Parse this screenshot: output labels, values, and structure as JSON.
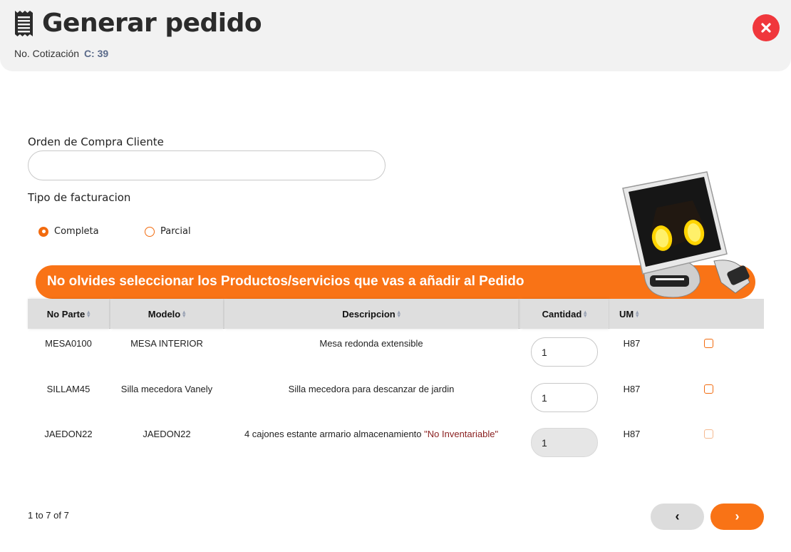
{
  "header": {
    "title": "Generar pedido",
    "quote_label": "No. Cotización",
    "quote_value": "C: 39"
  },
  "form": {
    "oc_label": "Orden de Compra Cliente",
    "oc_value": "",
    "billing_label": "Tipo de facturacion",
    "billing_options": [
      {
        "label": "Completa",
        "selected": true
      },
      {
        "label": "Parcial",
        "selected": false
      }
    ]
  },
  "banner": {
    "text": "No olvides seleccionar los Productos/servicios que vas a añadir al Pedido"
  },
  "table": {
    "columns": [
      "No Parte",
      "Modelo",
      "Descripcion",
      "Cantidad",
      "UM"
    ],
    "rows": [
      {
        "part": "MESA0100",
        "model": "MESA INTERIOR",
        "description": "Mesa redonda extensible",
        "note": "",
        "qty": "1",
        "um": "H87",
        "editable": true,
        "checked": false
      },
      {
        "part": "SILLAM45",
        "model": "Silla mecedora Vanely",
        "description": "Silla mecedora para descanzar de jardin",
        "note": "",
        "qty": "1",
        "um": "H87",
        "editable": true,
        "checked": false
      },
      {
        "part": "JAEDON22",
        "model": "JAEDON22",
        "description": "4 cajones estante armario almacenamiento",
        "note": "\"No Inventariable\"",
        "qty": "1",
        "um": "H87",
        "editable": false,
        "checked": false
      }
    ]
  },
  "pagination": {
    "info": "1 to 7 of 7",
    "prev_label": "‹",
    "next_label": "›"
  },
  "colors": {
    "accent": "#f97316",
    "close": "#f0373c",
    "header_bg": "#f2f2f2"
  },
  "icons": {
    "title": "receipt-icon",
    "close": "close-icon",
    "mascot": "robot-mascot"
  }
}
